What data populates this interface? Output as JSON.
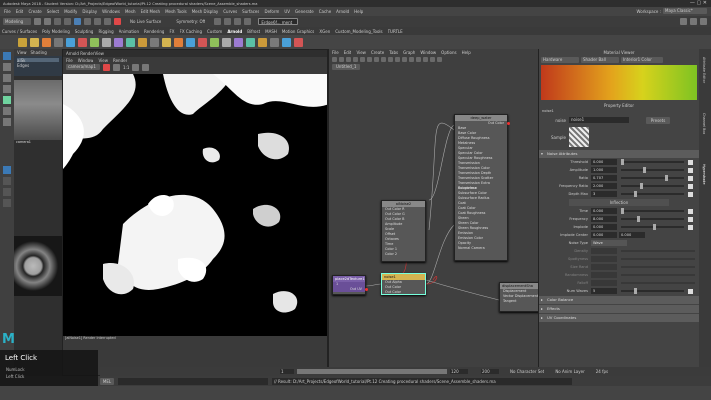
{
  "window": {
    "title": "Autodesk Maya 2018 - Student Version: D:/Art_Projects/EdgeofWorld_tutorial/Pt.12 Creating procedural shaders/Scene_Assemble_shaders.ma"
  },
  "menubar": {
    "items": [
      "File",
      "Edit",
      "Create",
      "Select",
      "Modify",
      "Display",
      "Windows",
      "Mesh",
      "Edit Mesh",
      "Mesh Tools",
      "Mesh Display",
      "Curves",
      "Surfaces",
      "Deform",
      "UV",
      "Generate",
      "Cache",
      "Arnold",
      "Help"
    ],
    "workspace_label": "Workspace :",
    "workspace_value": "Maya Classic*"
  },
  "statusline": {
    "mode": "Modeling",
    "no_live_surface": "No Live Surface",
    "symmetry": "Symmetry: Off",
    "search": "Erdge6f... ment"
  },
  "shelf": {
    "tabs": [
      "Curves / Surfaces",
      "Poly Modeling",
      "Sculpting",
      "Rigging",
      "Animation",
      "Rendering",
      "FX",
      "FX Caching",
      "Custom",
      "Arnold",
      "Bifrost",
      "MASH",
      "Motion Graphics",
      "XGen",
      "Custom_Modeling_Tools",
      "TURTLE"
    ],
    "active": "Arnold"
  },
  "outliner": {
    "tabs": [
      "View",
      "Shading"
    ],
    "items": [
      "aiSk",
      "Edges"
    ],
    "label": "camera1"
  },
  "render_view": {
    "title": "Arnold RenderView",
    "menus": [
      "File",
      "Window",
      "View",
      "Render"
    ],
    "camera": "camera/map1",
    "zoom": "1:1",
    "status": "[aiNoise1] Render Interrupted"
  },
  "node_editor": {
    "menus": [
      "File",
      "Edit",
      "View",
      "Create",
      "Tabs",
      "Graph",
      "Window",
      "Options",
      "Help"
    ],
    "tab": "Untitled_1",
    "nodes": {
      "deep_water": {
        "title": "deep_water",
        "out": "Out Color",
        "ports": [
          "Base",
          "Base Color",
          "Diffuse Roughness",
          "Metalness",
          "Specular",
          "Specular Color",
          "Specular Roughness",
          "Transmission",
          "Transmission Color",
          "Transmission Depth",
          "Transmission Scatter",
          "Transmission Extra Roughness",
          "Subsurface",
          "Subsurface Color",
          "Subsurface Radius",
          "Coat",
          "Coat Color",
          "Coat Roughness",
          "Sheen",
          "Sheen Color",
          "Sheen Roughness",
          "Emission",
          "Emission Color",
          "Opacity",
          "Normal Camera"
        ]
      },
      "aiNoise2": {
        "title": "aiNoise2",
        "out": "Out Color",
        "ports": [
          "Out Color R",
          "Out Color G",
          "Out Color B",
          "Amplitude",
          "Scale",
          "Offset",
          "Octaves",
          "Time",
          "Color 1",
          "Color 2"
        ]
      },
      "noise1": {
        "title": "noise1",
        "out": "Out Color",
        "ports": [
          "Out Alpha",
          "Out Color",
          "Out Color"
        ]
      },
      "place2d": {
        "title": "place2dTexture1",
        "out": "Out UV",
        "ports": [
          "1"
        ]
      },
      "displacement": {
        "title": "displacementSha",
        "ports": [
          "Displacement",
          "Vector Displacement",
          "Tangent"
        ]
      }
    }
  },
  "property": {
    "panel_title": "Property Editor",
    "material_viewer": "Material Viewer",
    "viewer_mode": "Hardware",
    "viewer_shape": "Shader Ball",
    "viewer_color": "Interior1 Color",
    "node_name": "noise1",
    "name_label": "noise",
    "name_value": "noise1",
    "presets": "Presets",
    "sample_label": "Sample",
    "section_noise": "Noise Attributes",
    "attrs": [
      {
        "label": "Threshold",
        "value": "0.000",
        "pos": 0.0
      },
      {
        "label": "Amplitude",
        "value": "1.000",
        "pos": 0.35
      },
      {
        "label": "Ratio",
        "value": "0.707",
        "pos": 0.7
      },
      {
        "label": "Frequency Ratio",
        "value": "2.000",
        "pos": 0.3
      },
      {
        "label": "Depth Max",
        "value": "3",
        "pos": 0.2
      }
    ],
    "inflection": "Inflection",
    "attrs2": [
      {
        "label": "Time",
        "value": "0.000",
        "pos": 0.0
      },
      {
        "label": "Frequency",
        "value": "8.000",
        "pos": 0.25
      },
      {
        "label": "Implode",
        "value": "0.000",
        "pos": 0.5
      }
    ],
    "implode_center_label": "Implode Center",
    "implode_center": [
      "0.000",
      "0.000"
    ],
    "noise_type_label": "Noise Type",
    "noise_type": "Wave",
    "disabled": [
      "Density",
      "Spottyness",
      "Size Rand",
      "Randomness",
      "Falloff"
    ],
    "num_waves_label": "Num Waves",
    "num_waves": "5",
    "sections": [
      "Color Balance",
      "Effects",
      "UV Coordinates"
    ]
  },
  "side_tabs": [
    "Attribute Editor",
    "Channel Box",
    "Hypershade"
  ],
  "timeline": {
    "start": "1",
    "end": "120",
    "range_start": "120",
    "range_end": "200",
    "character": "No Character Set",
    "anim_layer": "No Anim Layer",
    "fps": "24 fps"
  },
  "command": {
    "lang": "MEL",
    "result": "// Result: D:/Art_Projects/EdgeofWorld_tutorial/Pt.12 Creating procedural shaders/Scene_Assemble_shaders.ma"
  },
  "overlay": {
    "left_click": "Left Click",
    "numlock": "NumLock",
    "sub": "Left Click"
  }
}
